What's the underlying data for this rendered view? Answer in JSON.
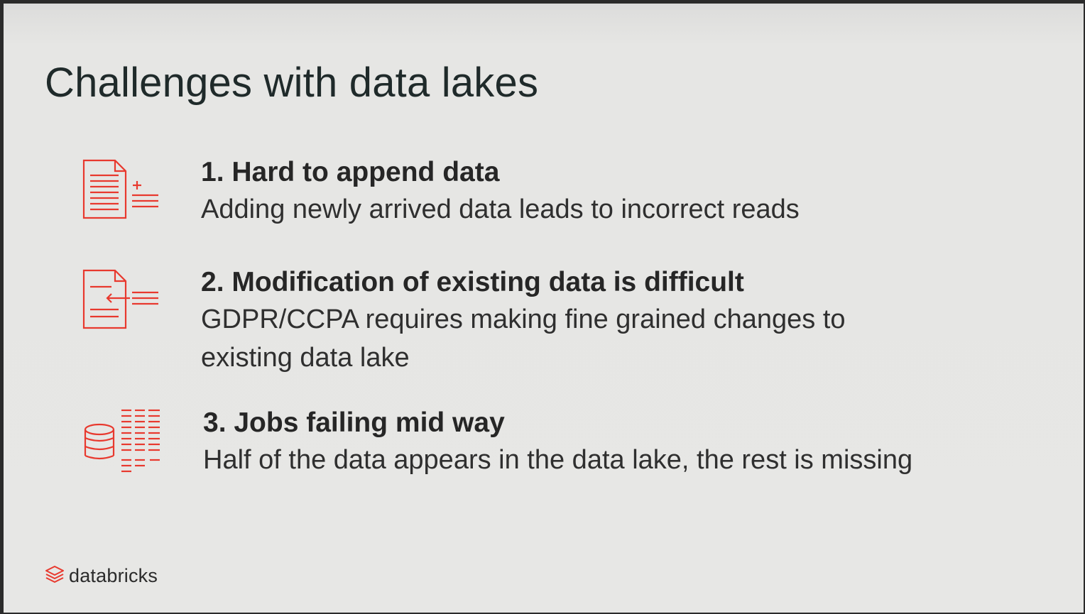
{
  "slide": {
    "title": "Challenges with data lakes",
    "items": [
      {
        "heading": "1. Hard to append data",
        "description": "Adding newly arrived data leads to incorrect reads",
        "icon": "document-append-icon"
      },
      {
        "heading": "2. Modification of existing data is difficult",
        "description": "GDPR/CCPA requires making fine grained changes to existing data lake",
        "icon": "document-modify-icon"
      },
      {
        "heading": "3. Jobs failing mid way",
        "description": "Half of the data appears in the data lake, the rest is missing",
        "icon": "database-partial-icon"
      }
    ],
    "logo": {
      "text": "databricks",
      "icon": "databricks-logo-icon"
    }
  },
  "colors": {
    "accent": "#e8392e",
    "background": "#e7e7e5",
    "text": "#262626"
  }
}
